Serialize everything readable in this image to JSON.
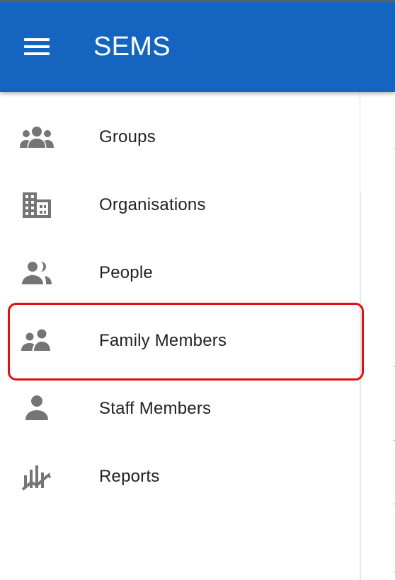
{
  "header": {
    "title": "SEMS",
    "menu_icon": "hamburger-menu-icon",
    "color": "#1565c0"
  },
  "nav": {
    "items": [
      {
        "label": "Groups",
        "icon": "groups-icon"
      },
      {
        "label": "Organisations",
        "icon": "building-icon"
      },
      {
        "label": "People",
        "icon": "people-icon"
      },
      {
        "label": "Family Members",
        "icon": "family-icon",
        "highlighted": true
      },
      {
        "label": "Staff Members",
        "icon": "person-icon"
      },
      {
        "label": "Reports",
        "icon": "reports-chart-icon"
      }
    ]
  },
  "colors": {
    "icon": "#757575",
    "text": "#222222",
    "highlight_border": "#e01010"
  }
}
